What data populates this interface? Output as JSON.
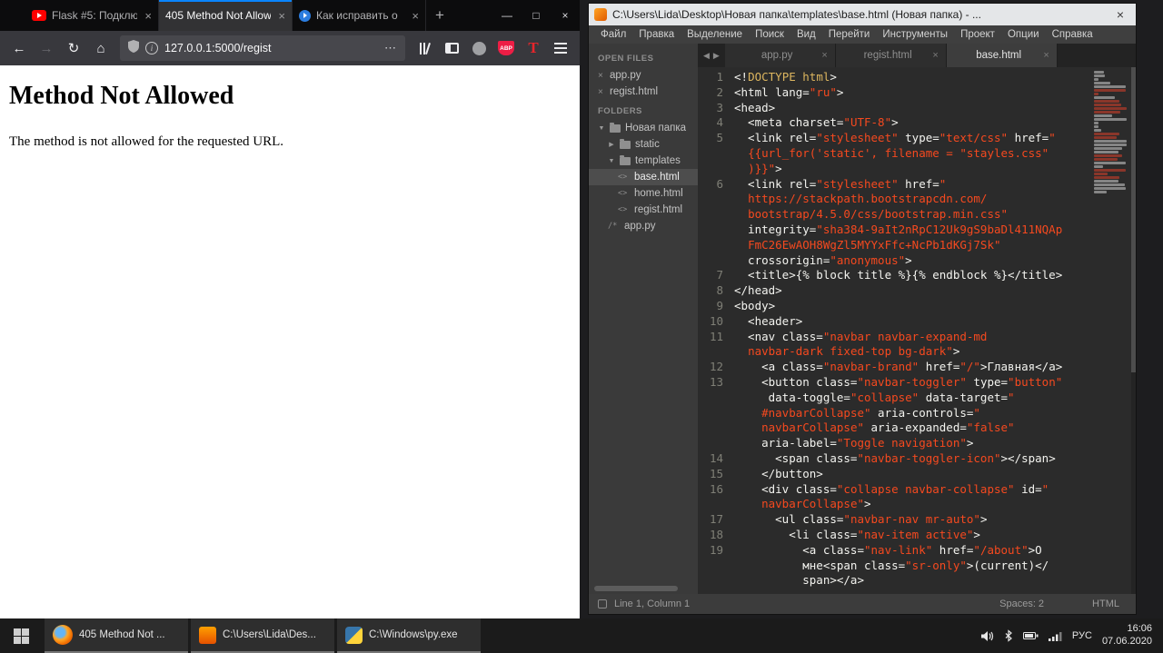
{
  "colors": {
    "firefox_accent": "#0a84ff",
    "string_orange": "#f5491f",
    "abp_red": "#ed1e45",
    "sublime_orange": "#e65100"
  },
  "firefox": {
    "tabbar": {
      "tabs": [
        {
          "title": "Flask #5: Подклю",
          "icon": "youtube",
          "active": false
        },
        {
          "title": "405 Method Not Allow",
          "icon": "none",
          "active": true
        },
        {
          "title": "Как исправить о",
          "icon": "video",
          "active": false
        }
      ],
      "new_tab_label": "+",
      "window_controls": {
        "minimize": "—",
        "maximize": "□",
        "close": "×"
      }
    },
    "nav": {
      "back_icon": "←",
      "forward_icon": "→",
      "reload_icon": "↻",
      "home_icon": "⌂",
      "info_glyph": "i",
      "abp_label": "ABP",
      "t_label": "T",
      "url": "127.0.0.1:5000/regist",
      "page_actions_glyph": "⋯"
    },
    "page": {
      "heading": "Method Not Allowed",
      "body": "The method is not allowed for the requested URL."
    }
  },
  "sublime": {
    "title": "C:\\Users\\Lida\\Desktop\\Новая папка\\templates\\base.html (Новая папка) - ...",
    "close_glyph": "×",
    "menu": [
      "Файл",
      "Правка",
      "Выделение",
      "Поиск",
      "Вид",
      "Перейти",
      "Инструменты",
      "Проект",
      "Опции",
      "Справка"
    ],
    "sidebar": {
      "open_files_label": "OPEN FILES",
      "open_files": [
        {
          "name": "app.py"
        },
        {
          "name": "regist.html"
        }
      ],
      "folders_label": "FOLDERS",
      "tree": [
        {
          "label": "Новая папка",
          "type": "folder",
          "expanded": true,
          "depth": 0,
          "selected": false
        },
        {
          "label": "static",
          "type": "folder",
          "expanded": false,
          "depth": 1,
          "selected": false
        },
        {
          "label": "templates",
          "type": "folder",
          "expanded": true,
          "depth": 1,
          "selected": false
        },
        {
          "label": "base.html",
          "type": "file-html",
          "depth": 2,
          "selected": true
        },
        {
          "label": "home.html",
          "type": "file-html",
          "depth": 2,
          "selected": false
        },
        {
          "label": "regist.html",
          "type": "file-html",
          "depth": 2,
          "selected": false
        },
        {
          "label": "app.py",
          "type": "file-py",
          "depth": 1,
          "selected": false
        }
      ]
    },
    "tab_scroll": {
      "left": "◀",
      "right": "▶"
    },
    "tabs": [
      {
        "label": "app.py",
        "active": false
      },
      {
        "label": "regist.html",
        "active": false
      },
      {
        "label": "base.html",
        "active": true
      }
    ],
    "code_rows": [
      {
        "n": "1",
        "seg": [
          [
            "<!",
            "w"
          ],
          [
            "DOCTYPE html",
            "k"
          ],
          [
            ">",
            "w"
          ]
        ]
      },
      {
        "n": "2",
        "seg": [
          [
            "<html lang=",
            "w"
          ],
          [
            "\"ru\"",
            "s"
          ],
          [
            ">",
            "w"
          ]
        ]
      },
      {
        "n": "3",
        "seg": [
          [
            "<head>",
            "w"
          ]
        ]
      },
      {
        "n": "4",
        "seg": [
          [
            "  <meta charset=",
            "w"
          ],
          [
            "\"UTF-8\"",
            "s"
          ],
          [
            ">",
            "w"
          ]
        ]
      },
      {
        "n": "5",
        "seg": [
          [
            "  <link rel=",
            "w"
          ],
          [
            "\"stylesheet\"",
            "s"
          ],
          [
            " type=",
            "w"
          ],
          [
            "\"text/css\"",
            "s"
          ],
          [
            " href=",
            "w"
          ],
          [
            "\"",
            "s"
          ]
        ]
      },
      {
        "n": "",
        "seg": [
          [
            "  ",
            "w"
          ],
          [
            "{{url_for('static', filename = \"stayles.css\"",
            "s"
          ]
        ]
      },
      {
        "n": "",
        "seg": [
          [
            "  ",
            "w"
          ],
          [
            ")}}\"",
            "s"
          ],
          [
            ">",
            "w"
          ]
        ]
      },
      {
        "n": "6",
        "seg": [
          [
            "  <link rel=",
            "w"
          ],
          [
            "\"stylesheet\"",
            "s"
          ],
          [
            " href=",
            "w"
          ],
          [
            "\"",
            "s"
          ]
        ]
      },
      {
        "n": "",
        "seg": [
          [
            "  ",
            "w"
          ],
          [
            "https://stackpath.bootstrapcdn.com/",
            "s"
          ]
        ]
      },
      {
        "n": "",
        "seg": [
          [
            "  ",
            "w"
          ],
          [
            "bootstrap/4.5.0/css/bootstrap.min.css\"",
            "s"
          ]
        ]
      },
      {
        "n": "",
        "seg": [
          [
            "  integrity=",
            "w"
          ],
          [
            "\"sha384-9aIt2nRpC12Uk9gS9baDl411NQAp",
            "s"
          ]
        ]
      },
      {
        "n": "",
        "seg": [
          [
            "  ",
            "w"
          ],
          [
            "FmC26EwAOH8WgZl5MYYxFfc+NcPb1dKGj7Sk\"",
            "s"
          ]
        ]
      },
      {
        "n": "",
        "seg": [
          [
            "  crossorigin=",
            "w"
          ],
          [
            "\"anonymous\"",
            "s"
          ],
          [
            ">",
            "w"
          ]
        ]
      },
      {
        "n": "7",
        "seg": [
          [
            "  <title>{% block title %}{% endblock %}</title>",
            "w"
          ]
        ]
      },
      {
        "n": "8",
        "seg": [
          [
            "</head>",
            "w"
          ]
        ]
      },
      {
        "n": "9",
        "seg": [
          [
            "<body>",
            "w"
          ]
        ]
      },
      {
        "n": "10",
        "seg": [
          [
            "  <header>",
            "w"
          ]
        ]
      },
      {
        "n": "11",
        "seg": [
          [
            "  <nav class=",
            "w"
          ],
          [
            "\"navbar navbar-expand-md",
            "s"
          ]
        ]
      },
      {
        "n": "",
        "seg": [
          [
            "  ",
            "w"
          ],
          [
            "navbar-dark fixed-top bg-dark\"",
            "s"
          ],
          [
            ">",
            "w"
          ]
        ]
      },
      {
        "n": "12",
        "seg": [
          [
            "    <a class=",
            "w"
          ],
          [
            "\"navbar-brand\"",
            "s"
          ],
          [
            " href=",
            "w"
          ],
          [
            "\"/\"",
            "s"
          ],
          [
            ">Главная</a>",
            "w"
          ]
        ]
      },
      {
        "n": "13",
        "seg": [
          [
            "    <button class=",
            "w"
          ],
          [
            "\"navbar-toggler\"",
            "s"
          ],
          [
            " type=",
            "w"
          ],
          [
            "\"button\"",
            "s"
          ]
        ]
      },
      {
        "n": "",
        "seg": [
          [
            "     data-toggle=",
            "w"
          ],
          [
            "\"collapse\"",
            "s"
          ],
          [
            " data-target=",
            "w"
          ],
          [
            "\"",
            "s"
          ]
        ]
      },
      {
        "n": "",
        "seg": [
          [
            "    ",
            "w"
          ],
          [
            "#navbarCollapse\"",
            "s"
          ],
          [
            " aria-controls=",
            "w"
          ],
          [
            "\"",
            "s"
          ]
        ]
      },
      {
        "n": "",
        "seg": [
          [
            "    ",
            "w"
          ],
          [
            "navbarCollapse\"",
            "s"
          ],
          [
            " aria-expanded=",
            "w"
          ],
          [
            "\"false\"",
            "s"
          ]
        ]
      },
      {
        "n": "",
        "seg": [
          [
            "    aria-label=",
            "w"
          ],
          [
            "\"Toggle navigation\"",
            "s"
          ],
          [
            ">",
            "w"
          ]
        ]
      },
      {
        "n": "14",
        "seg": [
          [
            "      <span class=",
            "w"
          ],
          [
            "\"navbar-toggler-icon\"",
            "s"
          ],
          [
            "></span>",
            "w"
          ]
        ]
      },
      {
        "n": "15",
        "seg": [
          [
            "    </button>",
            "w"
          ]
        ]
      },
      {
        "n": "16",
        "seg": [
          [
            "    <div class=",
            "w"
          ],
          [
            "\"collapse navbar-collapse\"",
            "s"
          ],
          [
            " id=",
            "w"
          ],
          [
            "\"",
            "s"
          ]
        ]
      },
      {
        "n": "",
        "seg": [
          [
            "    ",
            "w"
          ],
          [
            "navbarCollapse\"",
            "s"
          ],
          [
            ">",
            "w"
          ]
        ]
      },
      {
        "n": "17",
        "seg": [
          [
            "      <ul class=",
            "w"
          ],
          [
            "\"navbar-nav mr-auto\"",
            "s"
          ],
          [
            ">",
            "w"
          ]
        ]
      },
      {
        "n": "18",
        "seg": [
          [
            "        <li class=",
            "w"
          ],
          [
            "\"nav-item active\"",
            "s"
          ],
          [
            ">",
            "w"
          ]
        ]
      },
      {
        "n": "19",
        "seg": [
          [
            "          <a class=",
            "w"
          ],
          [
            "\"nav-link\"",
            "s"
          ],
          [
            " href=",
            "w"
          ],
          [
            "\"/about\"",
            "s"
          ],
          [
            ">О",
            "w"
          ]
        ]
      },
      {
        "n": "",
        "seg": [
          [
            "          мне<span class=",
            "w"
          ],
          [
            "\"sr-only\"",
            "s"
          ],
          [
            ">(current)</",
            "w"
          ]
        ]
      },
      {
        "n": "",
        "seg": [
          [
            "          span></a>",
            "w"
          ]
        ]
      }
    ],
    "status": {
      "line_col": "Line 1, Column 1",
      "spaces": "Spaces: 2",
      "syntax": "HTML"
    }
  },
  "taskbar": {
    "apps": [
      {
        "label": "405 Method Not ...",
        "icon": "firefox"
      },
      {
        "label": "C:\\Users\\Lida\\Des...",
        "icon": "sublime"
      },
      {
        "label": "C:\\Windows\\py.exe",
        "icon": "python"
      }
    ],
    "tray": {
      "lang": "РУС",
      "time": "16:06",
      "date": "07.06.2020"
    }
  }
}
